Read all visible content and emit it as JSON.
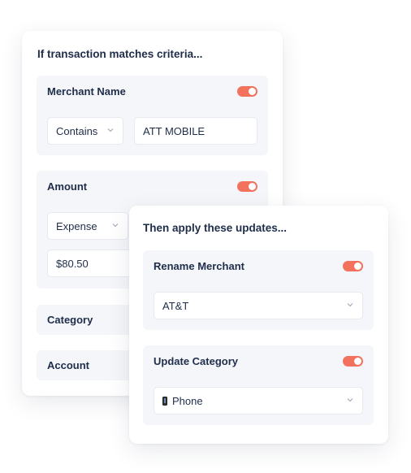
{
  "criteria": {
    "heading": "If transaction matches criteria...",
    "merchant_name": {
      "title": "Merchant Name",
      "enabled": true,
      "operator": "Contains",
      "value": "ATT MOBILE"
    },
    "amount": {
      "title": "Amount",
      "enabled": true,
      "type": "Expense",
      "value": "$80.50"
    },
    "category": {
      "title": "Category"
    },
    "account": {
      "title": "Account"
    }
  },
  "updates": {
    "heading": "Then apply these updates...",
    "rename_merchant": {
      "title": "Rename Merchant",
      "enabled": true,
      "value": "AT&T"
    },
    "update_category": {
      "title": "Update Category",
      "enabled": true,
      "value": "Phone",
      "icon": "phone-icon"
    }
  },
  "colors": {
    "toggle_on": "#f2725d",
    "panel_bg": "#f4f6f9",
    "text": "#1f2d4a"
  }
}
